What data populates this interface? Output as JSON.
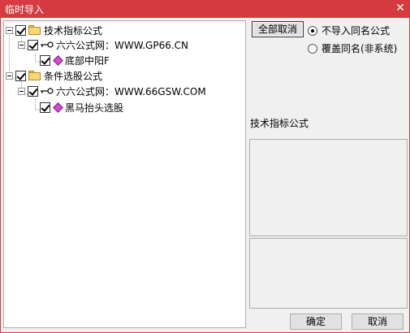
{
  "window": {
    "title": "临时导入",
    "close_glyph": "✕"
  },
  "tree": [
    {
      "label": "技术指标公式"
    },
    {
      "label": "六六公式网：WWW.GP66.CN"
    },
    {
      "label": "底部中阳F"
    },
    {
      "label": "条件选股公式"
    },
    {
      "label": "六六公式网：WWW.66GSW.COM"
    },
    {
      "label": "黑马抬头选股"
    }
  ],
  "options": {
    "cancel_all_label": "全部取消",
    "radio_no_import": "不导入同名公式",
    "radio_overwrite": "覆盖同名(非系统)",
    "selected": "不导入同名公式"
  },
  "detail": {
    "category_label": "技术指标公式"
  },
  "footer": {
    "ok_label": "确定",
    "cancel_label": "取消"
  }
}
